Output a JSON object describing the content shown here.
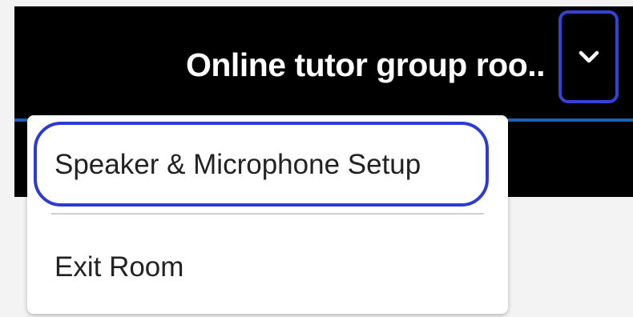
{
  "header": {
    "room_title": "Online tutor group roo..",
    "dropdown_icon": "chevron-down-icon"
  },
  "menu": {
    "items": [
      {
        "label": "Speaker & Microphone Setup"
      },
      {
        "label": "Exit Room"
      }
    ]
  },
  "colors": {
    "header_bg": "#000000",
    "header_accent": "#1f5fb8",
    "highlight": "#2e3bd0",
    "background": "#f3f3f3"
  }
}
